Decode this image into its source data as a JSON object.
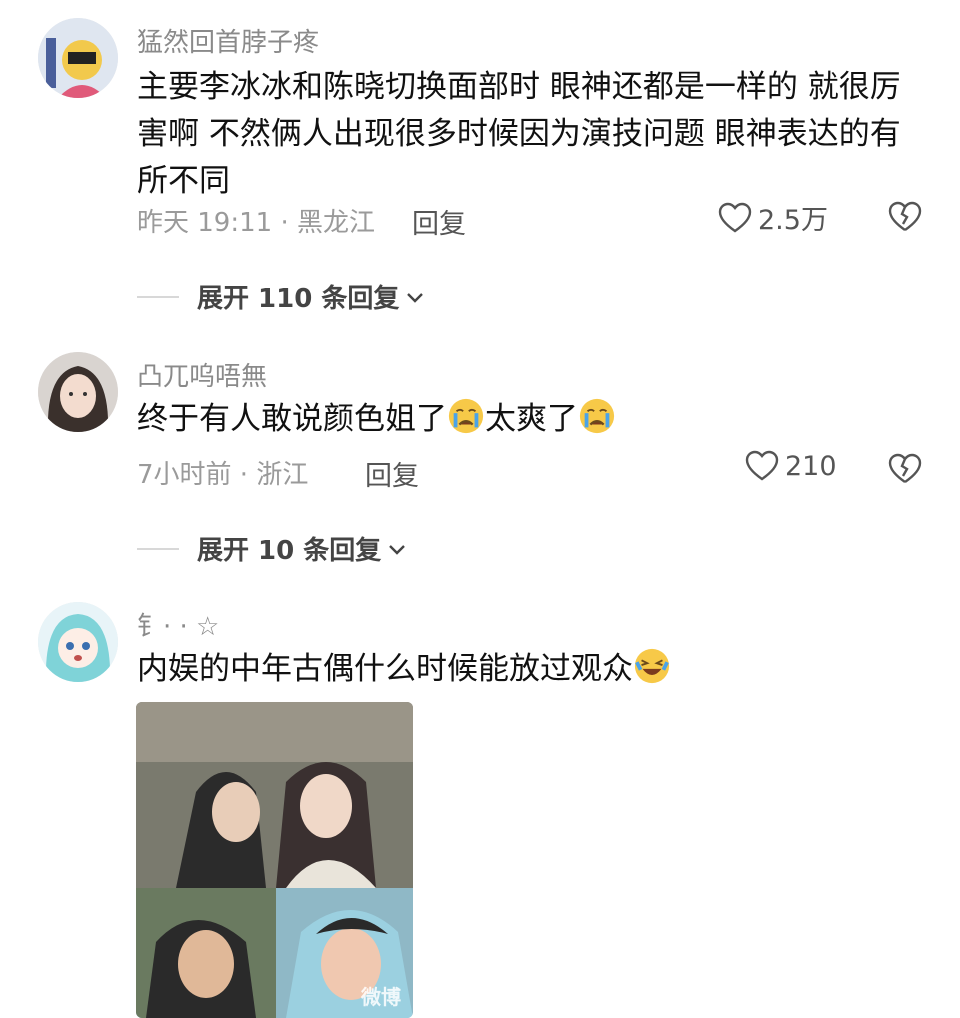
{
  "comments": [
    {
      "username": "猛然回首脖子疼",
      "text": "主要李冰冰和陈晓切换面部时 眼神还都是一样的 就很厉害啊 不然俩人出现很多时候因为演技问题 眼神表达的有所不同",
      "meta": "昨天 19:11 · 黑龙江",
      "reply_label": "回复",
      "likes": "2.5万",
      "expand_label": "展开 110 条回复"
    },
    {
      "username": "凸兀呜唔無",
      "text_parts": [
        "终于有人敢说颜色姐了",
        "太爽了"
      ],
      "meta": "7小时前 · 浙江",
      "reply_label": "回复",
      "likes": "210",
      "expand_label": "展开 10 条回复"
    },
    {
      "username": "钅· · ☆",
      "text": "内娱的中年古偶什么时候能放过观众",
      "image_watermark": "微博"
    }
  ],
  "icons": [
    "heart-icon",
    "broken-heart-icon",
    "chevron-down-icon",
    "crying-emoji-icon",
    "laughing-emoji-icon"
  ],
  "colors": {
    "username": "#8a8a8a",
    "meta": "#9a9a9a",
    "text": "#111111",
    "emoji": "#f7c948"
  }
}
